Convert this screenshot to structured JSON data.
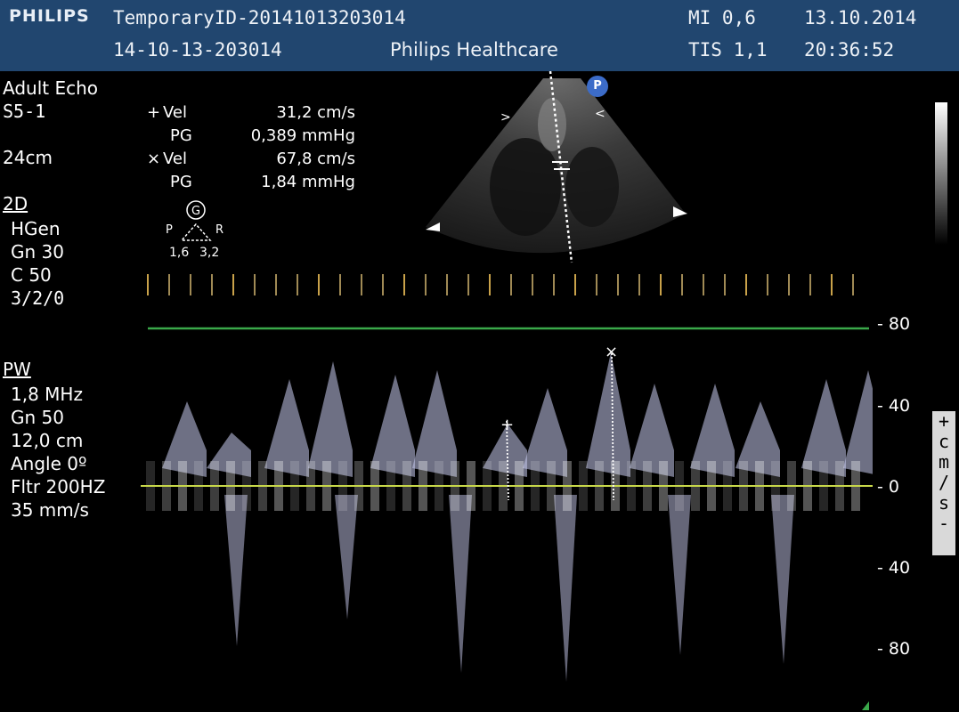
{
  "header": {
    "brand": "PHILIPS",
    "patient_id": "TemporaryID-20141013203014",
    "exam_id": "14-10-13-203014",
    "institution": "Philips Healthcare",
    "mi": "MI 0,6",
    "tis": "TIS 1,1",
    "date": "13.10.2014",
    "time": "20:36:52"
  },
  "left_panel": {
    "preset": "Adult Echo",
    "transducer": "S5-1",
    "depth": "24cm",
    "mode_2d": "2D",
    "hgen": "HGen",
    "gn": "Gn 30",
    "c": "C 50",
    "persist": "3/2/0",
    "mode_pw": "PW",
    "pw_freq": "1,8 MHz",
    "pw_gn": "Gn 50",
    "pw_depth": "12,0 cm",
    "pw_angle": "Angle 0º",
    "pw_filter": "Fltr 200HZ",
    "pw_speed": "35 mm/s"
  },
  "measurements": [
    {
      "marker": "+",
      "label": "Vel",
      "value": "31,2 cm/s"
    },
    {
      "marker": "",
      "label": "PG",
      "value": "0,389 mmHg"
    },
    {
      "marker": "×",
      "label": "Vel",
      "value": "67,8 cm/s"
    },
    {
      "marker": "",
      "label": "PG",
      "value": "1,84 mmHg"
    }
  ],
  "orientation_icon": {
    "letter": "G",
    "left_label": "P",
    "right_label": "R",
    "left_value": "1,6",
    "right_value": "3,2"
  },
  "sector_badge": "P",
  "scale": {
    "ticks": [
      "80",
      "40",
      "0",
      "40",
      "80"
    ],
    "unit_chars": [
      "+",
      "c",
      "m",
      "/",
      "s",
      "-"
    ]
  },
  "colors": {
    "header_bg": "#21466f",
    "baseline": "#c8d84a",
    "limit_line": "#3aa84a",
    "spectrum": "#c9ccf0"
  }
}
